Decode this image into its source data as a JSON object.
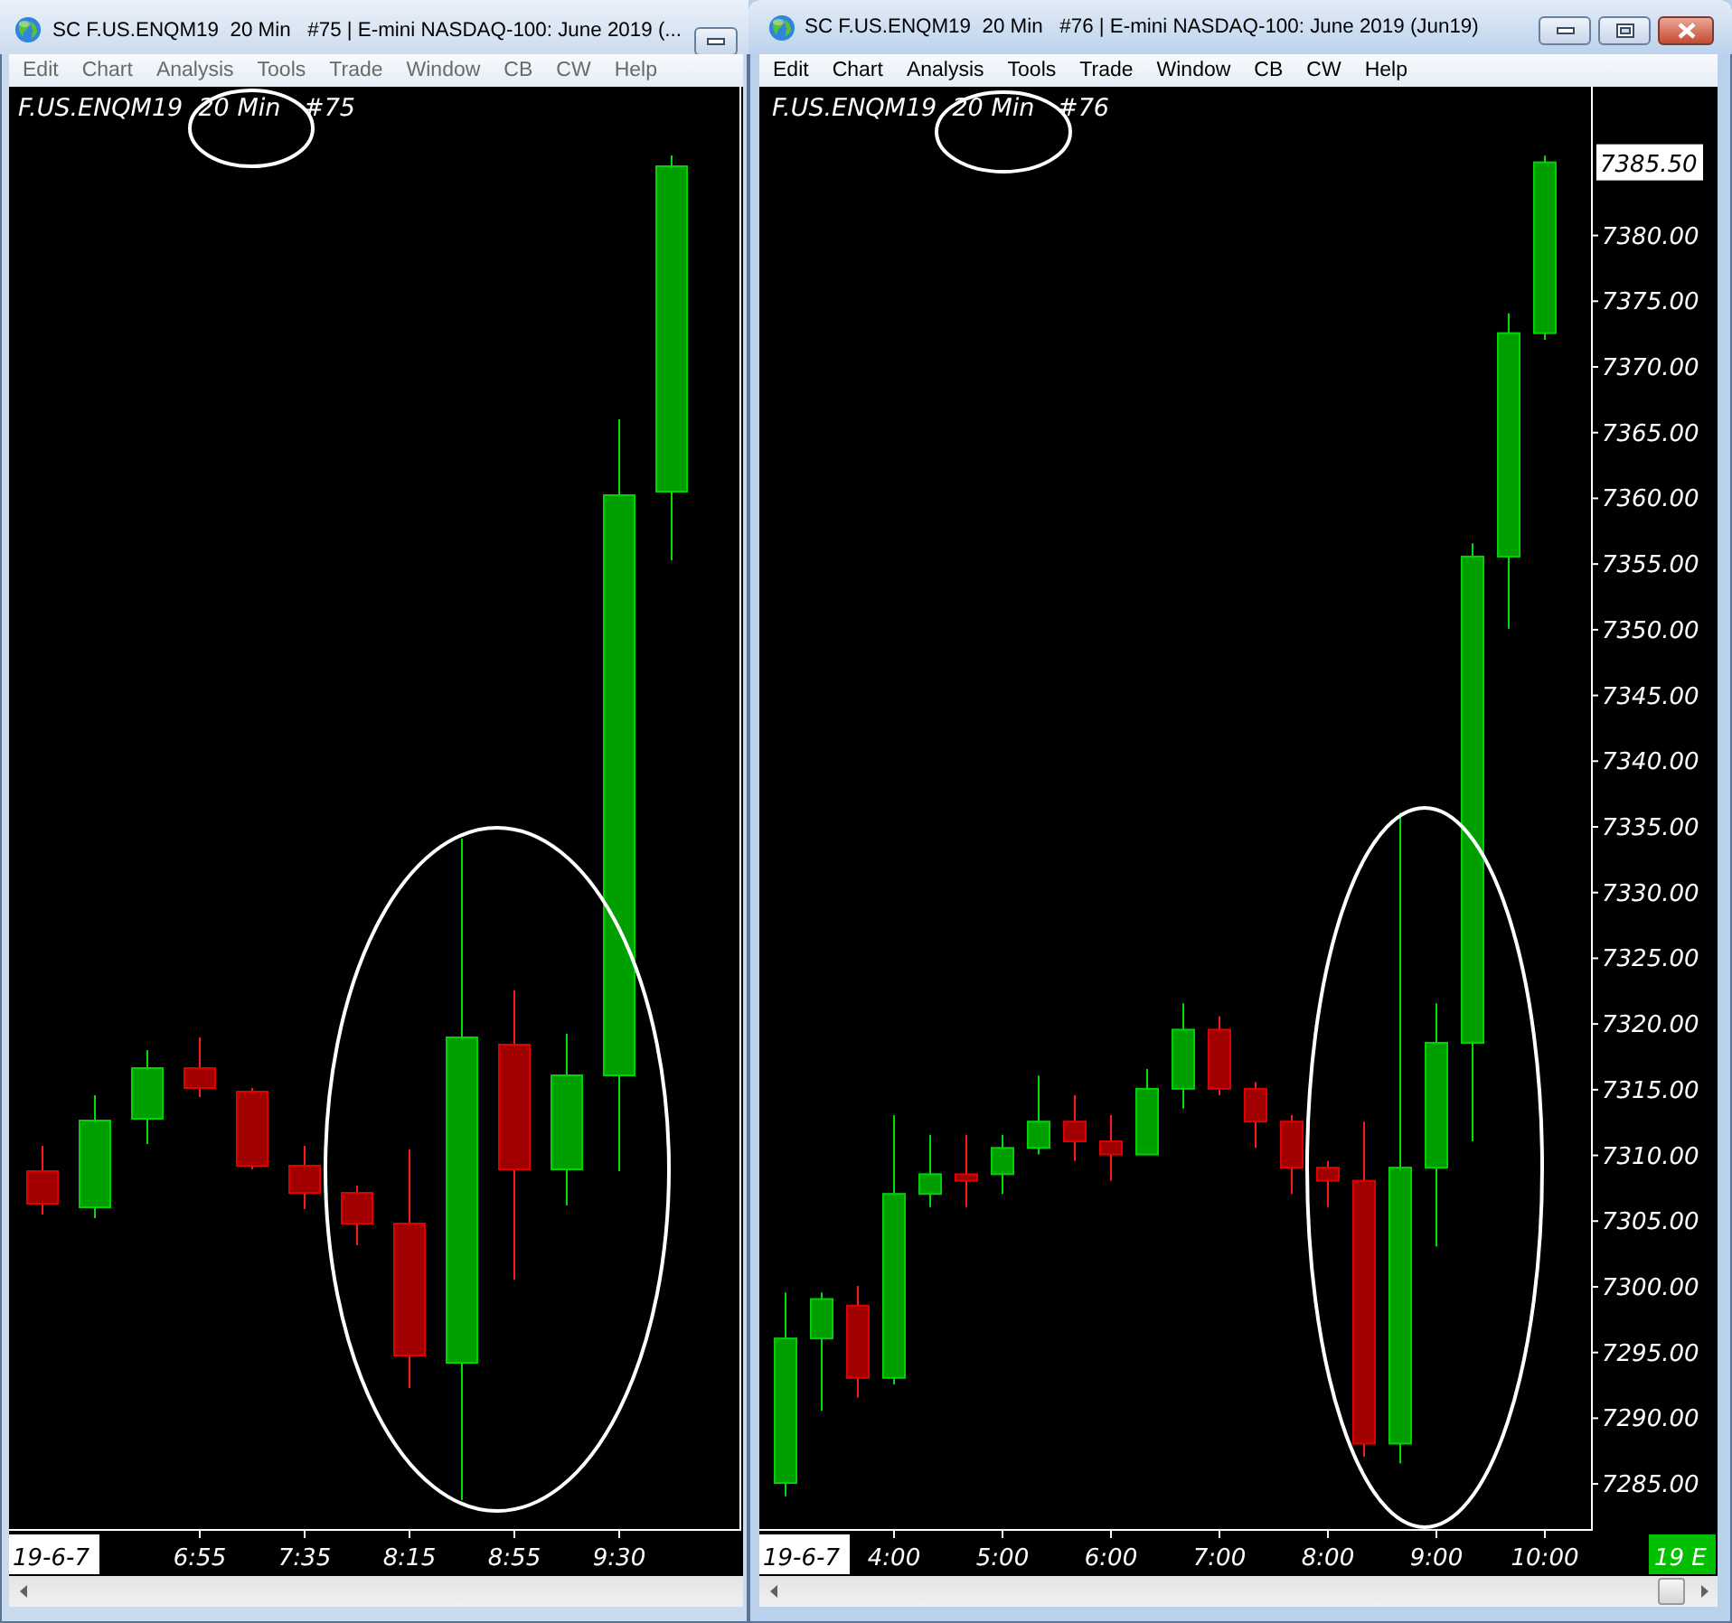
{
  "windows": [
    {
      "title": "SC F.US.ENQM19  20 Min   #75 | E-mini NASDAQ-100: June 2019 (...",
      "active": false,
      "title_buttons": [
        {
          "kind": "minimize"
        }
      ],
      "menu": [
        "Edit",
        "Chart",
        "Analysis",
        "Tools",
        "Trade",
        "Window",
        "CB",
        "CW",
        "Help"
      ],
      "chart": {
        "legend": "F.US.ENQM19  20 Min   #75",
        "date_label": "19-6-7",
        "time_labels": [
          "6:55",
          "7:35",
          "8:15",
          "8:55",
          "9:30"
        ],
        "hand_drawn_marks": [
          {
            "kind": "ellipse"
          },
          {
            "kind": "ellipse"
          }
        ]
      }
    },
    {
      "title": "SC F.US.ENQM19  20 Min   #76 | E-mini NASDAQ-100: June 2019 (Jun19)",
      "active": true,
      "title_buttons": [
        {
          "kind": "minimize"
        },
        {
          "kind": "maximize"
        },
        {
          "kind": "close"
        }
      ],
      "menu": [
        "Edit",
        "Chart",
        "Analysis",
        "Tools",
        "Trade",
        "Window",
        "CB",
        "CW",
        "Help"
      ],
      "chart": {
        "legend": "F.US.ENQM19  20 Min   #76",
        "date_label": "19-6-7",
        "current_time_label": "19 E",
        "last_price_label": "7385.50",
        "hand_drawn_marks": [
          {
            "kind": "ellipse"
          },
          {
            "kind": "ellipse"
          }
        ],
        "chart_data": {
          "type": "candlestick",
          "ylim": [
            7281.5,
            7391.25
          ],
          "categories": [
            null,
            null,
            null,
            "4:00",
            null,
            null,
            "5:00",
            null,
            null,
            "6:00",
            null,
            null,
            "7:00",
            null,
            null,
            "8:00",
            null,
            null,
            "9:00",
            null,
            null,
            "10:00"
          ],
          "yticks": [
            {
              "value": 7285,
              "label": "7285.00"
            },
            {
              "value": 7290,
              "label": "7290.00"
            },
            {
              "value": 7295,
              "label": "7295.00"
            },
            {
              "value": 7300,
              "label": "7300.00"
            },
            {
              "value": 7305,
              "label": "7305.00"
            },
            {
              "value": 7310,
              "label": "7310.00"
            },
            {
              "value": 7315,
              "label": "7315.00"
            },
            {
              "value": 7320,
              "label": "7320.00"
            },
            {
              "value": 7325,
              "label": "7325.00"
            },
            {
              "value": 7330,
              "label": "7330.00"
            },
            {
              "value": 7335,
              "label": "7335.00"
            },
            {
              "value": 7340,
              "label": "7340.00"
            },
            {
              "value": 7345,
              "label": "7345.00"
            },
            {
              "value": 7350,
              "label": "7350.00"
            },
            {
              "value": 7355,
              "label": "7355.00"
            },
            {
              "value": 7360,
              "label": "7360.00"
            },
            {
              "value": 7365,
              "label": "7365.00"
            },
            {
              "value": 7370,
              "label": "7370.00"
            },
            {
              "value": 7375,
              "label": "7375.00"
            },
            {
              "value": 7380,
              "label": "7380.00"
            }
          ],
          "ohlc": [
            [
              7285,
              7299.5,
              7284,
              7296
            ],
            [
              7296,
              7299.5,
              7290.5,
              7299
            ],
            [
              7298.5,
              7300,
              7291.5,
              7293
            ],
            [
              7293,
              7313,
              7292.5,
              7307
            ],
            [
              7307,
              7311.5,
              7306,
              7308.5
            ],
            [
              7308.5,
              7311.5,
              7306,
              7308
            ],
            [
              7308.5,
              7311.5,
              7307,
              7310.5
            ],
            [
              7310.5,
              7316,
              7310,
              7312.5
            ],
            [
              7312.5,
              7314.5,
              7309.5,
              7311
            ],
            [
              7311,
              7313,
              7308,
              7310
            ],
            [
              7310,
              7316.5,
              7310,
              7315
            ],
            [
              7315,
              7321.5,
              7313.5,
              7319.5
            ],
            [
              7319.5,
              7320.5,
              7314.5,
              7315
            ],
            [
              7315,
              7315.5,
              7310.5,
              7312.5
            ],
            [
              7312.5,
              7313,
              7307,
              7309
            ],
            [
              7309,
              7309.5,
              7306,
              7308
            ],
            [
              7308,
              7312.5,
              7287,
              7288
            ],
            [
              7288,
              7336,
              7286.5,
              7309
            ],
            [
              7309,
              7321.5,
              7303,
              7318.5
            ],
            [
              7318.5,
              7356.5,
              7311,
              7355.5
            ],
            [
              7355.5,
              7374,
              7350,
              7372.5
            ],
            [
              7372.5,
              7386,
              7372,
              7385.5
            ]
          ]
        }
      }
    }
  ]
}
